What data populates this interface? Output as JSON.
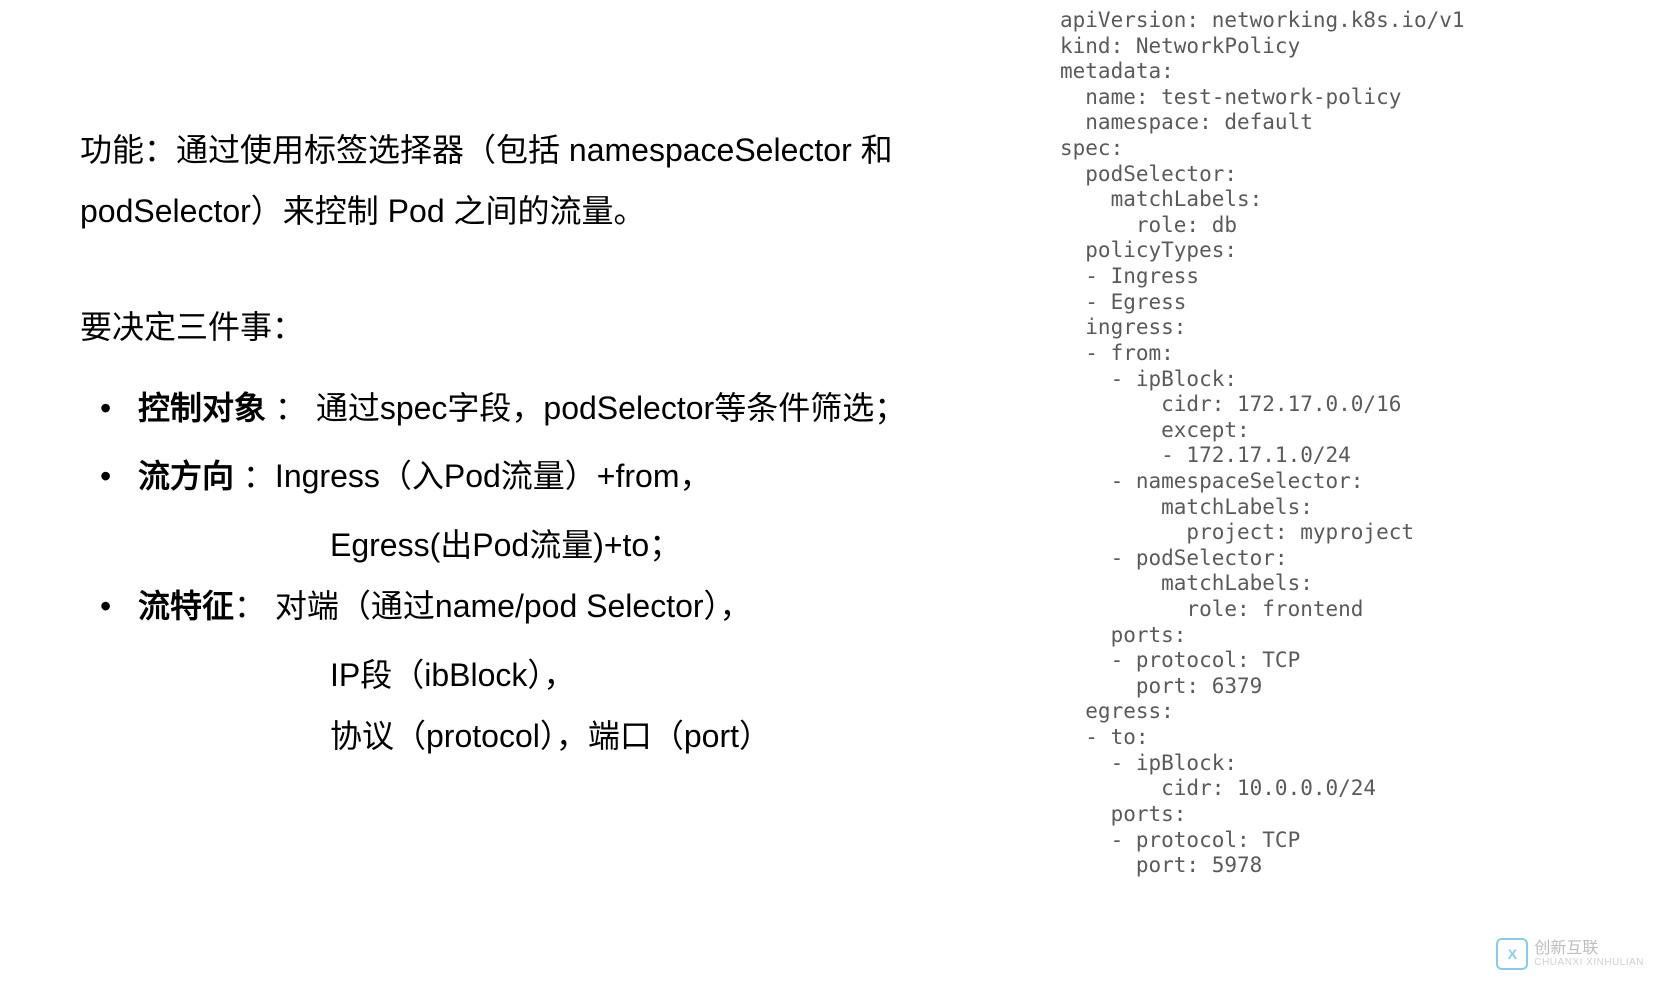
{
  "content": {
    "intro": "功能：通过使用标签选择器（包括 namespaceSelector 和 podSelector）来控制 Pod 之间的流量。",
    "subtitle": "要决定三件事：",
    "bullets": [
      {
        "label": "控制对象",
        "sep": " ：",
        "text": "通过spec字段，podSelector等条件筛选；",
        "continuations": []
      },
      {
        "label": "流方向",
        "sep": " ：",
        "text": "Ingress（入Pod流量）+from，",
        "continuations": [
          "Egress(出Pod流量)+to；"
        ]
      },
      {
        "label": "流特征",
        "sep": "：",
        "text": " 对端（通过name/pod Selector），",
        "continuations": [
          "IP段（ibBlock），",
          "协议（protocol），端口（port）"
        ]
      }
    ]
  },
  "code": "apiVersion: networking.k8s.io/v1\nkind: NetworkPolicy\nmetadata:\n  name: test-network-policy\n  namespace: default\nspec:\n  podSelector:\n    matchLabels:\n      role: db\n  policyTypes:\n  - Ingress\n  - Egress\n  ingress:\n  - from:\n    - ipBlock:\n        cidr: 172.17.0.0/16\n        except:\n        - 172.17.1.0/24\n    - namespaceSelector:\n        matchLabels:\n          project: myproject\n    - podSelector:\n        matchLabels:\n          role: frontend\n    ports:\n    - protocol: TCP\n      port: 6379\n  egress:\n  - to:\n    - ipBlock:\n        cidr: 10.0.0.0/24\n    ports:\n    - protocol: TCP\n      port: 5978",
  "watermark": {
    "brand": "创新互联",
    "sub": "CHUANXI XINHULIAN"
  }
}
